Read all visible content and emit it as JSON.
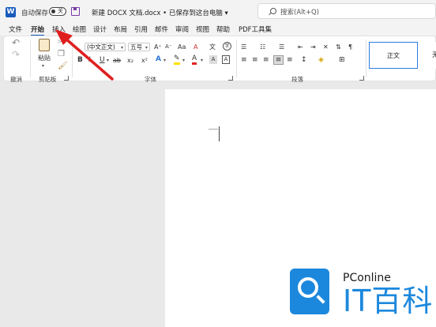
{
  "titlebar": {
    "app_icon": "W",
    "autosave_label": "自动保存",
    "autosave_state": "关",
    "doc_title": "新建 DOCX 文档.docx • 已保存到这台电脑 ▾",
    "search_placeholder": "搜索(Alt+Q)"
  },
  "tabs": [
    "文件",
    "开始",
    "插入",
    "绘图",
    "设计",
    "布局",
    "引用",
    "邮件",
    "审阅",
    "视图",
    "帮助",
    "PDF工具集"
  ],
  "active_tab": "开始",
  "ribbon": {
    "undo_group": {
      "label": "撤消"
    },
    "clipboard": {
      "label": "剪贴板",
      "paste": "粘贴"
    },
    "font": {
      "label": "字体",
      "font_name": "(中文正文)",
      "font_size": "五号",
      "bold": "B",
      "italic": "I",
      "underline": "U",
      "strike": "ab",
      "subscript": "x₂",
      "superscript": "x²",
      "text_effects": "A",
      "highlight": "✎",
      "font_color": "A",
      "grow": "A⁺",
      "shrink": "A⁻",
      "change_case": "Aa",
      "clear": "A",
      "phonetic": "文",
      "encircle": "字"
    },
    "paragraph": {
      "label": "段落"
    },
    "styles": {
      "normal": "正文",
      "next": "无"
    }
  },
  "watermark": {
    "top": "PConline",
    "bottom": "IT百科"
  },
  "colors": {
    "accent": "#185abd",
    "annotation_arrow": "#e01e1e",
    "watermark": "#1c88dd"
  }
}
